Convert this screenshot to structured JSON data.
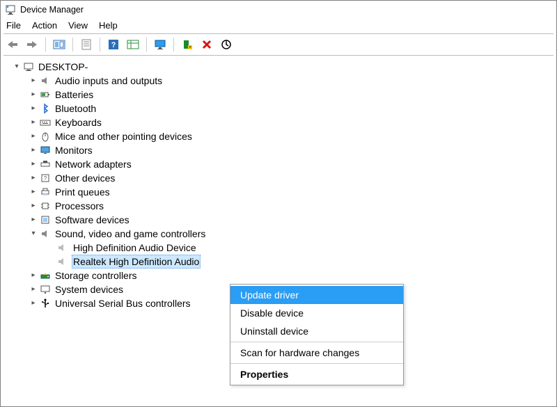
{
  "window": {
    "title": "Device Manager"
  },
  "menu": {
    "file": "File",
    "action": "Action",
    "view": "View",
    "help": "Help"
  },
  "toolbar_icons": {
    "back": "back-arrow",
    "forward": "forward-arrow",
    "show_hidden": "show-hidden",
    "properties": "properties",
    "help": "help",
    "details": "details",
    "monitor": "monitor",
    "add_legacy": "add-legacy",
    "delete": "delete",
    "scan": "scan"
  },
  "tree": {
    "root": "DESKTOP-",
    "items": [
      {
        "label": "Audio inputs and outputs",
        "expanded": false
      },
      {
        "label": "Batteries",
        "expanded": false
      },
      {
        "label": "Bluetooth",
        "expanded": false
      },
      {
        "label": "Keyboards",
        "expanded": false
      },
      {
        "label": "Mice and other pointing devices",
        "expanded": false
      },
      {
        "label": "Monitors",
        "expanded": false
      },
      {
        "label": "Network adapters",
        "expanded": false
      },
      {
        "label": "Other devices",
        "expanded": false
      },
      {
        "label": "Print queues",
        "expanded": false
      },
      {
        "label": "Processors",
        "expanded": false
      },
      {
        "label": "Software devices",
        "expanded": false
      },
      {
        "label": "Sound, video and game controllers",
        "expanded": true,
        "children": [
          {
            "label": "High Definition Audio Device"
          },
          {
            "label": "Realtek High Definition Audio",
            "selected": true
          }
        ]
      },
      {
        "label": "Storage controllers",
        "expanded": false
      },
      {
        "label": "System devices",
        "expanded": false
      },
      {
        "label": "Universal Serial Bus controllers",
        "expanded": false
      }
    ]
  },
  "context_menu": {
    "items": [
      {
        "label": "Update driver",
        "highlighted": true
      },
      {
        "label": "Disable device"
      },
      {
        "label": "Uninstall device"
      },
      {
        "divider": true
      },
      {
        "label": "Scan for hardware changes"
      },
      {
        "divider": true
      },
      {
        "label": "Properties",
        "bold": true
      }
    ]
  }
}
